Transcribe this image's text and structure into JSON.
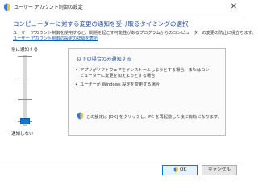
{
  "window": {
    "title": "ユーザー アカウント制御の設定",
    "close_glyph": "✕"
  },
  "main": {
    "heading": "コンピューターに対する変更の通知を受け取るタイミングの選択",
    "description": "ユーザー アカウント制御を使用すると、問題を起こす可能性があるプログラムからのコンピューターの変更の防止に役立ちます。",
    "link": "ユーザー アカウント制御の設定の詳細を表示"
  },
  "slider": {
    "top_label": "常に通知する",
    "bottom_label": "通知しない",
    "levels": 4,
    "selected_level": 4
  },
  "info": {
    "heading": "以下の場合のみ通知する",
    "bullet1_line1": "アプリがソフトウェアをインストールしようとする場合、またはコン",
    "bullet1_line2": "ピューターに変更を加えようとする場合",
    "bullet2": "ユーザーが Windows 設定を変更する場合",
    "bullet_glyph": "•",
    "note": "この設定は [OK] をクリックし、PC を再起動した後に有効になります。"
  },
  "buttons": {
    "ok": "OK",
    "cancel": "キャンセル"
  },
  "colors": {
    "accent": "#0a78d7",
    "heading": "#1f4e9c",
    "link": "#0a5fb4"
  }
}
